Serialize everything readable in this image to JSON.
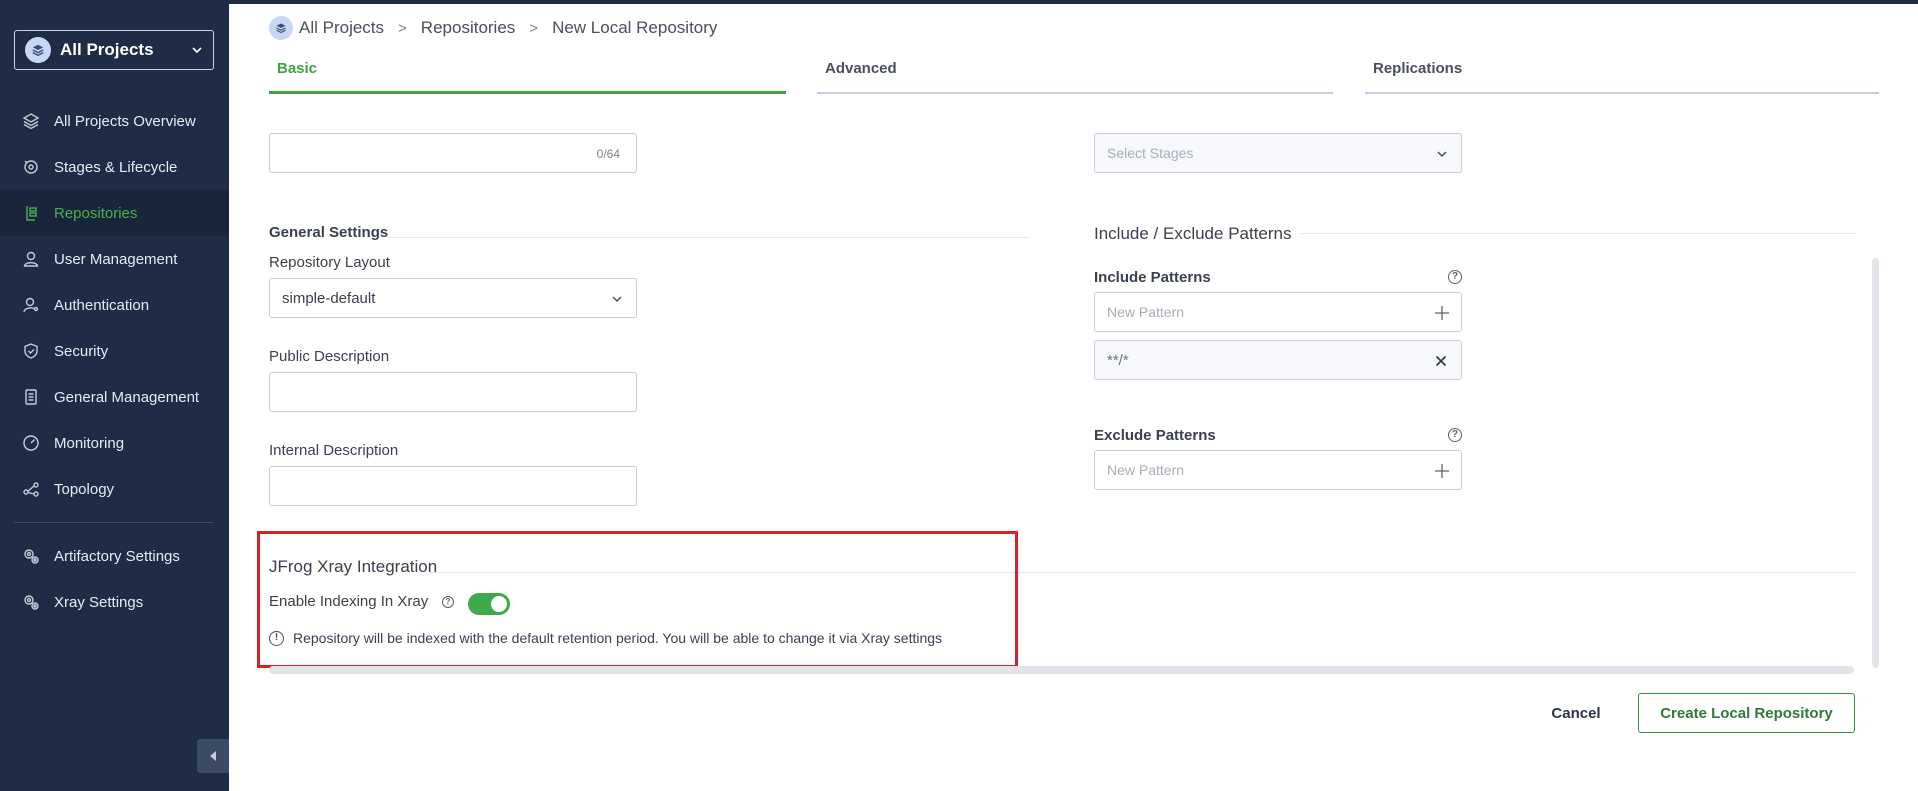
{
  "sidebar": {
    "project_selector": {
      "label": "All Projects",
      "icon": "layers-icon"
    },
    "items": [
      {
        "label": "All Projects Overview",
        "icon": "layers-icon",
        "active": false
      },
      {
        "label": "Stages & Lifecycle",
        "icon": "lifecycle-icon",
        "active": false
      },
      {
        "label": "Repositories",
        "icon": "repository-icon",
        "active": true
      },
      {
        "label": "User Management",
        "icon": "user-icon",
        "active": false
      },
      {
        "label": "Authentication",
        "icon": "user-key-icon",
        "active": false
      },
      {
        "label": "Security",
        "icon": "shield-icon",
        "active": false
      },
      {
        "label": "General Management",
        "icon": "document-icon",
        "active": false
      },
      {
        "label": "Monitoring",
        "icon": "gauge-icon",
        "active": false
      },
      {
        "label": "Topology",
        "icon": "topology-icon",
        "active": false
      }
    ],
    "settings_items": [
      {
        "label": "Artifactory Settings",
        "icon": "gears-icon"
      },
      {
        "label": "Xray Settings",
        "icon": "gears-icon"
      }
    ]
  },
  "breadcrumb": {
    "items": [
      "All Projects",
      "Repositories",
      "New Local Repository"
    ],
    "separator": ">"
  },
  "tabs": [
    {
      "label": "Basic",
      "active": true
    },
    {
      "label": "Advanced",
      "active": false
    },
    {
      "label": "Replications",
      "active": false
    }
  ],
  "form": {
    "top_input": {
      "value": "",
      "counter": "0/64"
    },
    "stages": {
      "placeholder": "Select Stages"
    },
    "general_settings": {
      "title": "General Settings",
      "repository_layout": {
        "label": "Repository Layout",
        "value": "simple-default"
      },
      "public_description": {
        "label": "Public Description",
        "value": ""
      },
      "internal_description": {
        "label": "Internal Description",
        "value": ""
      }
    },
    "patterns": {
      "title": "Include / Exclude Patterns",
      "include": {
        "label": "Include Patterns",
        "placeholder": "New Pattern",
        "values": [
          "**/*"
        ]
      },
      "exclude": {
        "label": "Exclude Patterns",
        "placeholder": "New Pattern"
      }
    },
    "xray": {
      "title": "JFrog Xray Integration",
      "enable_label": "Enable Indexing In Xray",
      "enabled": true,
      "info": "Repository will be indexed with the default retention period. You will be able to change it via Xray settings"
    }
  },
  "actions": {
    "cancel": "Cancel",
    "create": "Create Local Repository"
  },
  "colors": {
    "sidebar_bg": "#1e2d45",
    "accent_green": "#43a047",
    "highlight_red": "#e01e26"
  }
}
